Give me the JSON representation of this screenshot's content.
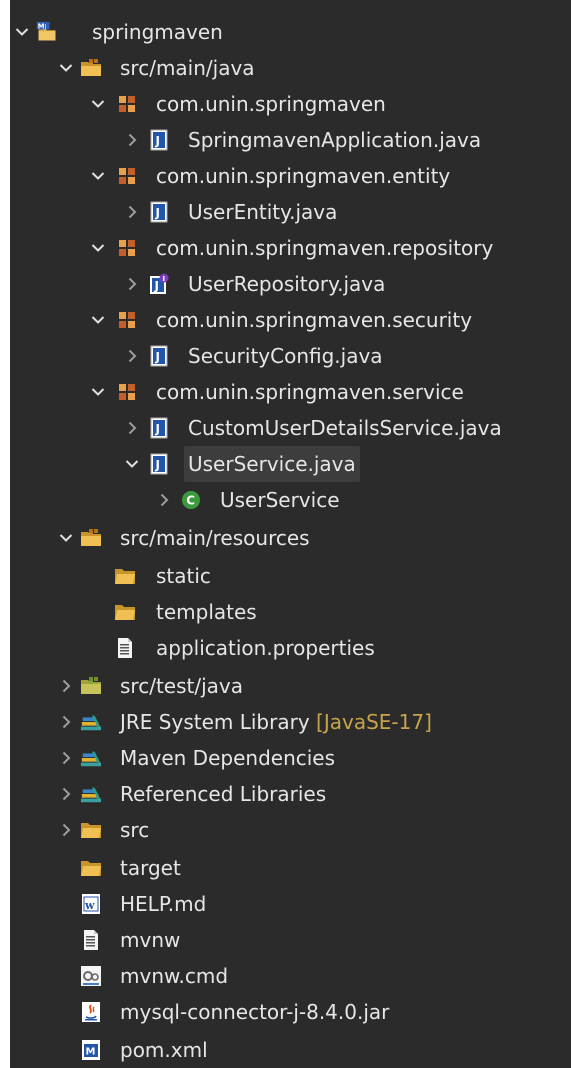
{
  "tree": {
    "items": [
      {
        "label": "springmaven",
        "icon": "maven-project-icon",
        "twisty": "open"
      },
      {
        "label": "src/main/java",
        "icon": "source-folder-icon",
        "twisty": "open"
      },
      {
        "label": "com.unin.springmaven",
        "icon": "package-icon",
        "twisty": "open"
      },
      {
        "label": "SpringmavenApplication.java",
        "icon": "java-file-icon",
        "twisty": "closed"
      },
      {
        "label": "com.unin.springmaven.entity",
        "icon": "package-icon",
        "twisty": "open"
      },
      {
        "label": "UserEntity.java",
        "icon": "java-file-icon",
        "twisty": "closed"
      },
      {
        "label": "com.unin.springmaven.repository",
        "icon": "package-icon",
        "twisty": "open"
      },
      {
        "label": "UserRepository.java",
        "icon": "java-interface-file-icon",
        "twisty": "closed"
      },
      {
        "label": "com.unin.springmaven.security",
        "icon": "package-icon",
        "twisty": "open"
      },
      {
        "label": "SecurityConfig.java",
        "icon": "java-file-icon",
        "twisty": "closed"
      },
      {
        "label": "com.unin.springmaven.service",
        "icon": "package-icon",
        "twisty": "open"
      },
      {
        "label": "CustomUserDetailsService.java",
        "icon": "java-file-icon",
        "twisty": "closed"
      },
      {
        "label": "UserService.java",
        "icon": "java-file-icon",
        "twisty": "open"
      },
      {
        "label": "UserService",
        "icon": "class-icon",
        "twisty": "closed"
      },
      {
        "label": "src/main/resources",
        "icon": "source-folder-icon",
        "twisty": "open"
      },
      {
        "label": "static",
        "icon": "folder-icon",
        "twisty": "none"
      },
      {
        "label": "templates",
        "icon": "folder-icon",
        "twisty": "none"
      },
      {
        "label": "application.properties",
        "icon": "text-file-icon",
        "twisty": "none"
      },
      {
        "label": "src/test/java",
        "icon": "test-source-folder-icon",
        "twisty": "closed"
      },
      {
        "label": "JRE System Library",
        "decoration": "[JavaSE-17]",
        "icon": "library-icon",
        "twisty": "closed"
      },
      {
        "label": "Maven Dependencies",
        "icon": "library-icon",
        "twisty": "closed"
      },
      {
        "label": "Referenced Libraries",
        "icon": "library-icon",
        "twisty": "closed"
      },
      {
        "label": "src",
        "icon": "folder-icon",
        "twisty": "closed"
      },
      {
        "label": "target",
        "icon": "folder-icon",
        "twisty": "none"
      },
      {
        "label": "HELP.md",
        "icon": "markdown-file-icon",
        "twisty": "none"
      },
      {
        "label": "mvnw",
        "icon": "text-file-icon",
        "twisty": "none"
      },
      {
        "label": "mvnw.cmd",
        "icon": "cmd-file-icon",
        "twisty": "none"
      },
      {
        "label": "mysql-connector-j-8.4.0.jar",
        "icon": "jar-file-icon",
        "twisty": "none"
      },
      {
        "label": "pom.xml",
        "icon": "maven-pom-icon",
        "twisty": "none"
      }
    ],
    "selected": "UserService.java"
  },
  "colors": {
    "background": "#2b2b2b",
    "text": "#e6e6e6",
    "decoration": "#c9a44b",
    "selection": "#3d3d3d"
  }
}
